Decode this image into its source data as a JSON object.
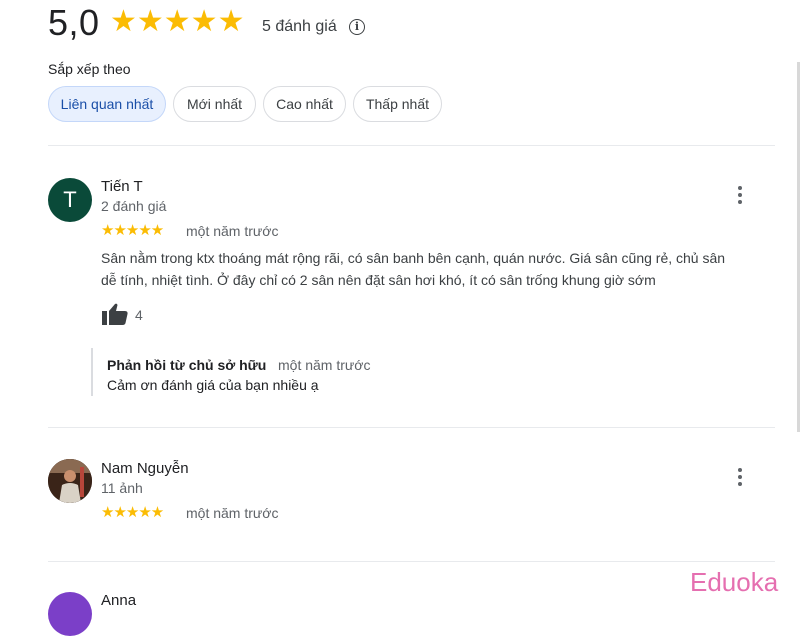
{
  "summary": {
    "score": "5,0",
    "stars": "★★★★★",
    "review_count": "5 đánh giá",
    "info_icon": "i"
  },
  "sort": {
    "label": "Sắp xếp theo",
    "chips": [
      "Liên quan nhất",
      "Mới nhất",
      "Cao nhất",
      "Thấp nhất"
    ],
    "active": "Liên quan nhất"
  },
  "reviews": [
    {
      "avatar_letter": "T",
      "name": "Tiến T",
      "meta": "2 đánh giá",
      "stars": "★★★★★",
      "time": "một năm trước",
      "text_line1": "Sân nằm trong ktx thoáng mát rộng rãi,  có sân banh bên cạnh,  quán nước.  Giá sân cũng rẻ, chủ sân",
      "text_line2": "dễ tính, nhiệt tình. Ở đây chỉ có 2 sân nên đặt sân hơi khó, ít có sân trống khung giờ sớm",
      "likes": "4",
      "reply": {
        "title": "Phản hồi từ chủ sở hữu",
        "time": "một năm trước",
        "text": "Cảm ơn đánh giá của bạn nhiều ạ"
      }
    },
    {
      "name": "Nam Nguyễn",
      "meta": "11 ảnh",
      "stars": "★★★★★",
      "time": "một năm trước"
    },
    {
      "name": "Anna"
    }
  ],
  "watermark": "Eduoka",
  "colors": {
    "star": "#fbbc04",
    "active_chip_bg": "#e8f0fe",
    "avatar_t": "#0a4a39",
    "watermark": "#e56fb0"
  }
}
